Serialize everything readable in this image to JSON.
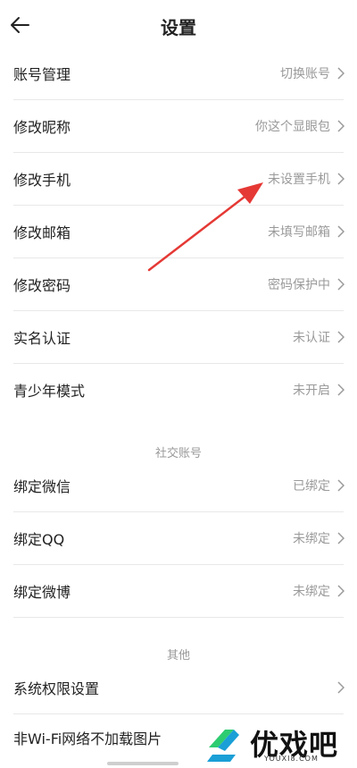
{
  "header": {
    "title": "设置"
  },
  "account_rows": [
    {
      "label": "账号管理",
      "value": "切换账号"
    },
    {
      "label": "修改昵称",
      "value": "你这个显眼包"
    },
    {
      "label": "修改手机",
      "value": "未设置手机"
    },
    {
      "label": "修改邮箱",
      "value": "未填写邮箱"
    },
    {
      "label": "修改密码",
      "value": "密码保护中"
    },
    {
      "label": "实名认证",
      "value": "未认证"
    },
    {
      "label": "青少年模式",
      "value": "未开启"
    }
  ],
  "social": {
    "title": "社交账号",
    "rows": [
      {
        "label": "绑定微信",
        "value": "已绑定"
      },
      {
        "label": "绑定QQ",
        "value": "未绑定"
      },
      {
        "label": "绑定微博",
        "value": "未绑定"
      }
    ]
  },
  "other": {
    "title": "其他",
    "rows": [
      {
        "label": "系统权限设置",
        "value": ""
      },
      {
        "label": "非Wi-Fi网络不加载图片",
        "value": ""
      }
    ]
  },
  "watermark": {
    "brand": "优戏吧",
    "url": "YOUXI8.COM"
  },
  "colors": {
    "arrow": "#e53935",
    "value_text": "#9a9a9a",
    "divider": "#e8e8e8"
  }
}
